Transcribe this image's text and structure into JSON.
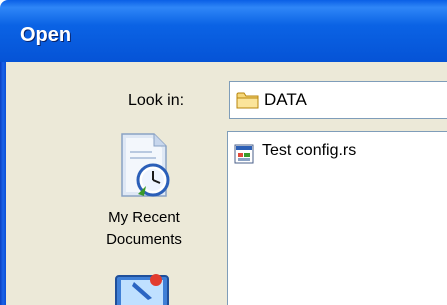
{
  "window": {
    "title": "Open"
  },
  "look_in": {
    "label": "Look in:",
    "value": "DATA",
    "icon": "folder-icon"
  },
  "places": [
    {
      "label_line1": "My Recent",
      "label_line2": "Documents",
      "icon": "recent-documents-icon"
    },
    {
      "label_line1": "",
      "label_line2": "",
      "icon": "desktop-icon"
    }
  ],
  "files": [
    {
      "name": "Test config.rs",
      "icon": "config-file-icon"
    }
  ],
  "colors": {
    "titlebar": "#0553d6",
    "dialog_background": "#ece9d8",
    "field_border": "#7f9db9"
  }
}
